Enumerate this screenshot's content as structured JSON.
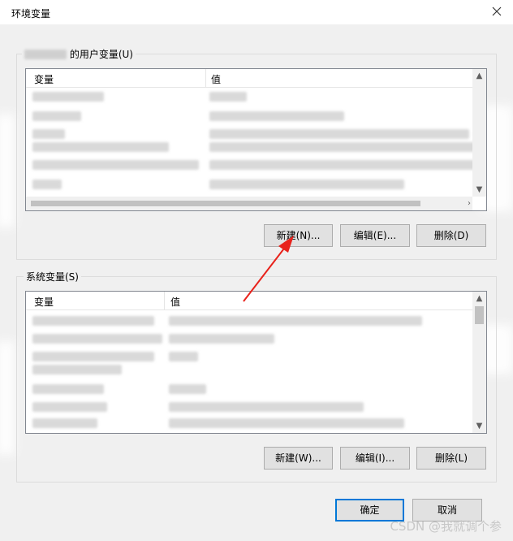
{
  "window": {
    "title": "环境变量"
  },
  "user_section": {
    "label": "的用户变量(U)",
    "columns": [
      "变量",
      "值"
    ],
    "buttons": {
      "new": "新建(N)...",
      "edit": "编辑(E)...",
      "delete": "删除(D)"
    }
  },
  "system_section": {
    "label": "系统变量(S)",
    "columns": [
      "变量",
      "值"
    ],
    "buttons": {
      "new": "新建(W)...",
      "edit": "编辑(I)...",
      "delete": "删除(L)"
    }
  },
  "footer": {
    "ok": "确定",
    "cancel": "取消"
  },
  "watermark": "CSDN @我就调个参",
  "colors": {
    "arrow": "#e8221b",
    "primary_border": "#0078d7"
  }
}
